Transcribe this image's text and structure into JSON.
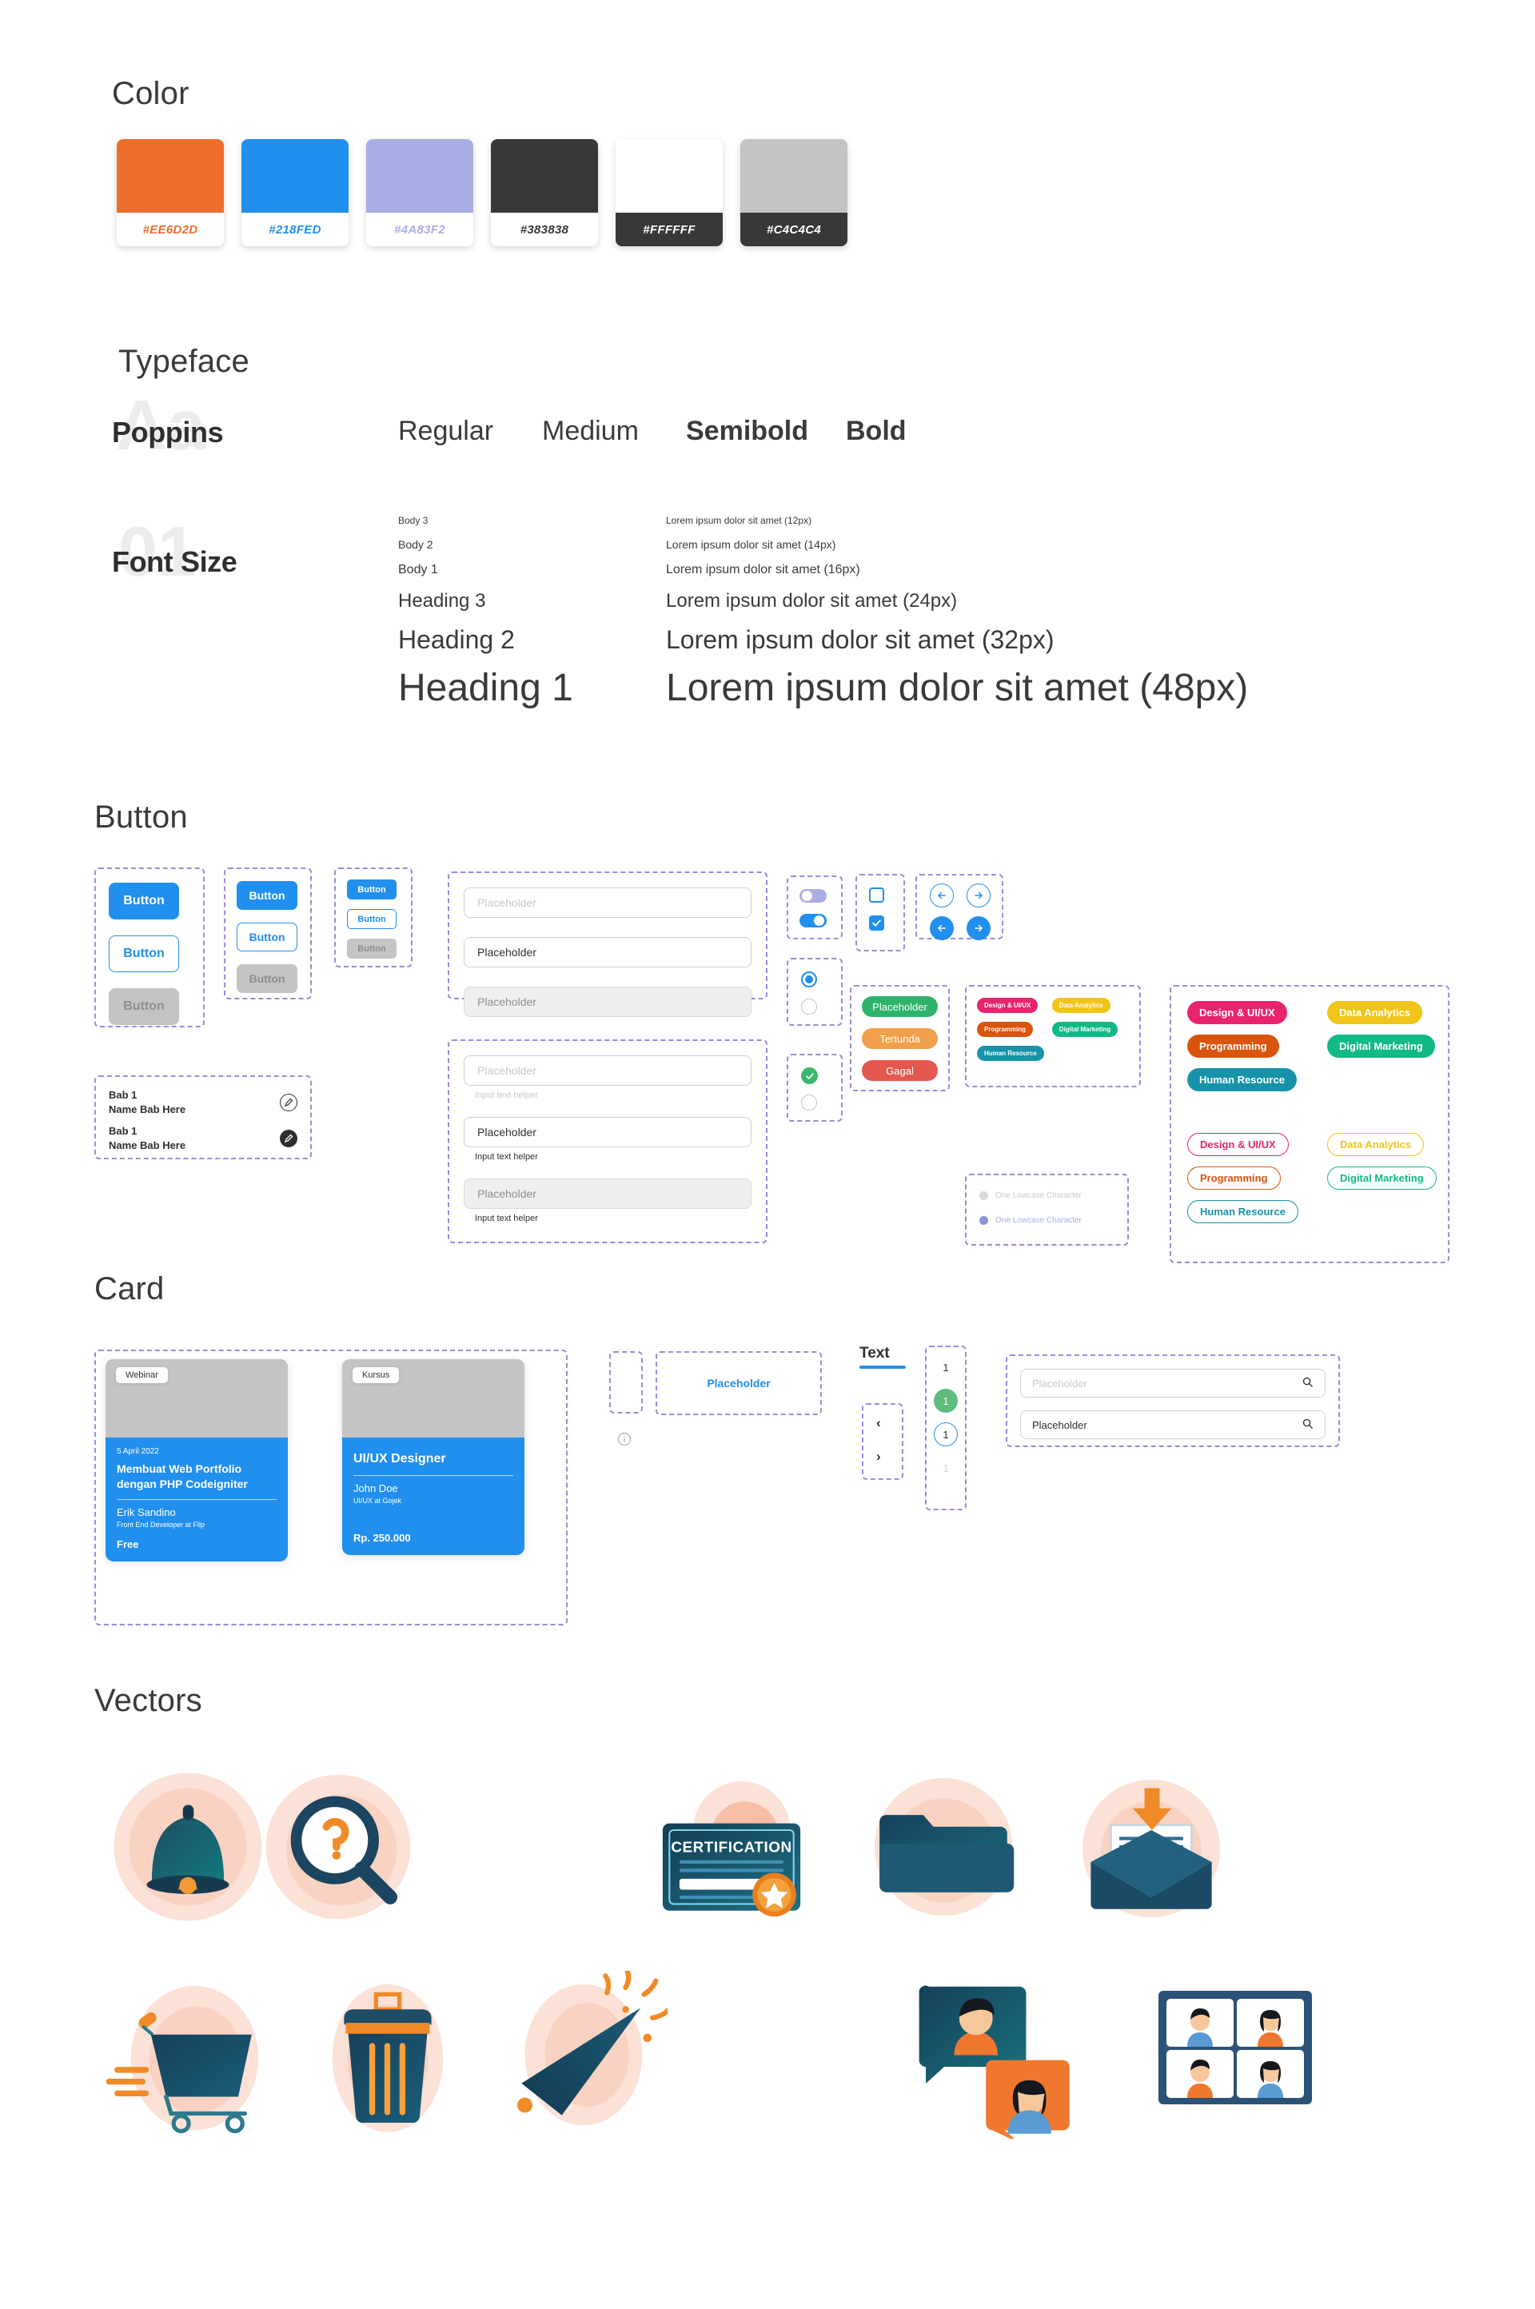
{
  "sections": {
    "color": "Color",
    "typeface": "Typeface",
    "button": "Button",
    "card": "Card",
    "vectors": "Vectors"
  },
  "colors": {
    "swatches": [
      {
        "hex": "#EE6D2D",
        "label": "#EE6D2D",
        "chip": "#EE6D2D",
        "label_color": "#EE6D2D",
        "label_bg": "#FFFFFF"
      },
      {
        "hex": "#218FED",
        "label": "#218FED",
        "chip": "#218FED",
        "label_color": "#218FED",
        "label_bg": "#FFFFFF"
      },
      {
        "hex": "#4A83F2",
        "label": "#4A83F2",
        "chip": "#A7AEE4",
        "label_color": "#A7AEE4",
        "label_bg": "#FFFFFF"
      },
      {
        "hex": "#383838",
        "label": "#383838",
        "chip": "#383838",
        "label_color": "#383838",
        "label_bg": "#FFFFFF"
      },
      {
        "hex": "#FFFFFF",
        "label": "#FFFFFF",
        "chip": "#FFFFFF",
        "label_color": "#FFFFFF",
        "label_bg": "#383838"
      },
      {
        "hex": "#C4C4C4",
        "label": "#C4C4C4",
        "chip": "#C4C4C4",
        "label_color": "#FFFFFF",
        "label_bg": "#383838"
      }
    ]
  },
  "typeface": {
    "ghost": "Aa",
    "family": "Poppins",
    "weights": [
      "Regular",
      "Medium",
      "Semibold",
      "Bold"
    ]
  },
  "font_size": {
    "ghost": "01",
    "title": "Font Size",
    "rows": [
      {
        "name": "Body 3",
        "sample": "Lorem ipsum dolor sit amet (12px)"
      },
      {
        "name": "Body 2",
        "sample": "Lorem ipsum dolor sit amet (14px)"
      },
      {
        "name": "Body 1",
        "sample": "Lorem ipsum dolor sit amet (16px)"
      },
      {
        "name": "Heading 3",
        "sample": "Lorem ipsum dolor sit amet (24px)"
      },
      {
        "name": "Heading 2",
        "sample": "Lorem ipsum dolor sit amet (32px)"
      },
      {
        "name": "Heading 1",
        "sample": "Lorem ipsum dolor sit amet (48px)"
      }
    ]
  },
  "buttons": {
    "label": "Button",
    "large": [
      "Button",
      "Button",
      "Button"
    ],
    "medium": [
      "Button",
      "Button",
      "Button"
    ],
    "small": [
      "Button",
      "Button",
      "Button"
    ]
  },
  "bab_list": [
    {
      "chapter": "Bab 1",
      "name": "Name Bab Here",
      "icon": "edit-outline-icon"
    },
    {
      "chapter": "Bab 1",
      "name": "Name Bab Here",
      "icon": "edit-filled-icon"
    }
  ],
  "inputs": {
    "placeholder": "Placeholder",
    "helper": "Input text helper",
    "group1": [
      {
        "state": "empty",
        "value": "Placeholder"
      },
      {
        "state": "filled",
        "value": "Placeholder"
      },
      {
        "state": "disabled",
        "value": "Placeholder"
      }
    ],
    "group2": [
      {
        "state": "empty",
        "value": "Placeholder",
        "helper": "Input text helper"
      },
      {
        "state": "filled",
        "value": "Placeholder",
        "helper": "Input text helper"
      },
      {
        "state": "disabled",
        "value": "Placeholder",
        "helper": "Input text helper"
      }
    ]
  },
  "status_pills": [
    {
      "label": "Placeholder",
      "color": "#2DB36A"
    },
    {
      "label": "Tertunda",
      "color": "#F0A04B"
    },
    {
      "label": "Gagal",
      "color": "#E4584F"
    }
  ],
  "password_rules": [
    {
      "label": "One Lowcase Character",
      "state": "inactive",
      "dot": "#D9D9D9",
      "text": "#C9C9C9"
    },
    {
      "label": "One Lowcase Character",
      "state": "active",
      "dot": "#8C93D8",
      "text": "#A7AEE4"
    }
  ],
  "chips": {
    "categories": [
      {
        "label": "Design & UI/UX",
        "color": "#E8246F"
      },
      {
        "label": "Data Analytics",
        "color": "#F0C419"
      },
      {
        "label": "Programming",
        "color": "#D9540D"
      },
      {
        "label": "Digital Marketing",
        "color": "#12B886"
      },
      {
        "label": "Human Resource",
        "color": "#1792A8"
      }
    ]
  },
  "cards": [
    {
      "tag": "Webinar",
      "date": "5 April 2022",
      "title": "Membuat Web Portfolio dengan PHP Codeigniter",
      "person": "Erik Sandino",
      "role": "Front End Developer at Flip",
      "price": "Free"
    },
    {
      "tag": "Kursus",
      "date": "",
      "title": "UI/UX Designer",
      "person": "John Doe",
      "role": "UI/UX at Gojek",
      "price": "Rp. 250.000"
    }
  ],
  "misc": {
    "placeholder_blue": "Placeholder",
    "tab_label": "Text",
    "prev": "‹",
    "next": "›",
    "pagination": [
      {
        "value": "1",
        "style": "plain"
      },
      {
        "value": "1",
        "style": "green"
      },
      {
        "value": "1",
        "style": "outline"
      },
      {
        "value": "1",
        "style": "muted"
      }
    ],
    "info_icon": "info-icon"
  },
  "search": [
    {
      "value": "Placeholder",
      "state": "empty",
      "icon": "search-icon"
    },
    {
      "value": "Placeholder",
      "state": "filled",
      "icon": "search-icon"
    }
  ],
  "vectors": {
    "row1": [
      "bell-icon",
      "search-question-icon",
      "certification-icon",
      "folder-icon",
      "open-mail-icon"
    ],
    "row2": [
      "shopping-cart-icon",
      "trash-can-icon",
      "party-popper-icon",
      "chat-people-icon",
      "video-call-grid-icon"
    ],
    "certificate_text": "CERTIFICATION"
  }
}
